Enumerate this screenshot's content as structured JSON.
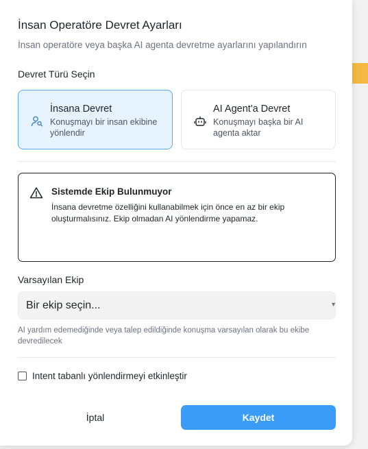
{
  "dialog": {
    "title": "İnsan Operatöre Devret Ayarları",
    "subtitle": "İnsan operatöre veya başka AI agenta devretme ayarlarını yapılandırın"
  },
  "handoff_type": {
    "label": "Devret Türü Seçin",
    "options": [
      {
        "title": "İnsana Devret",
        "description": "Konuşmayı bir insan ekibine yönlendir",
        "icon": "user-search-icon",
        "selected": true
      },
      {
        "title": "AI Agent'a Devret",
        "description": "Konuşmayı başka bir AI agenta aktar",
        "icon": "bot-icon",
        "selected": false
      }
    ]
  },
  "alert": {
    "icon": "warning-icon",
    "title": "Sistemde Ekip Bulunmuyor",
    "body": "İnsana devretme özelliğini kullanabilmek için önce en az bir ekip oluşturmalısınız. Ekip olmadan AI yönlendirme yapamaz."
  },
  "default_team": {
    "label": "Varsayılan Ekip",
    "value": "Bir ekip seçin...",
    "helper": "AI yardım edemediğinde veya talep edildiğinde konuşma varsayılan olarak bu ekibe devredilecek"
  },
  "intent_routing": {
    "label": "Intent tabanlı yönlendirmeyi etkinleştir",
    "checked": false
  },
  "actions": {
    "cancel_label": "İptal",
    "save_label": "Kaydet"
  },
  "colors": {
    "accent": "#3b9cf7",
    "selected_bg": "#e6f2fc",
    "selected_border": "#5aa7ea"
  }
}
